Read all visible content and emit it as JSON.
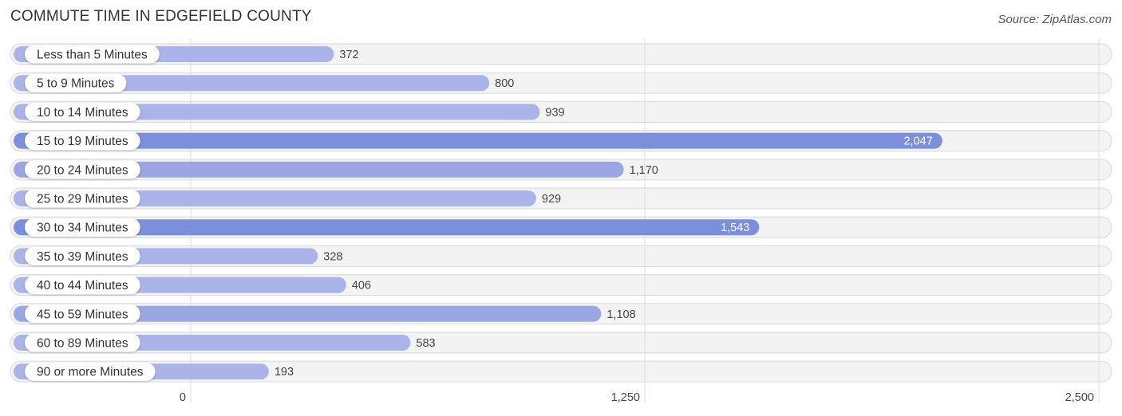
{
  "chart_data": {
    "type": "bar",
    "orientation": "horizontal",
    "title": "COMMUTE TIME IN EDGEFIELD COUNTY",
    "source": "Source: ZipAtlas.com",
    "categories": [
      "Less than 5 Minutes",
      "5 to 9 Minutes",
      "10 to 14 Minutes",
      "15 to 19 Minutes",
      "20 to 24 Minutes",
      "25 to 29 Minutes",
      "30 to 34 Minutes",
      "35 to 39 Minutes",
      "40 to 44 Minutes",
      "45 to 59 Minutes",
      "60 to 89 Minutes",
      "90 or more Minutes"
    ],
    "values": [
      372,
      800,
      939,
      2047,
      1170,
      929,
      1543,
      328,
      406,
      1108,
      583,
      193
    ],
    "value_labels": [
      "372",
      "800",
      "939",
      "2,047",
      "1,170",
      "929",
      "1,543",
      "328",
      "406",
      "1,108",
      "583",
      "193"
    ],
    "xlim": [
      0,
      2500
    ],
    "xticks": [
      0,
      1250,
      2500
    ],
    "xtick_labels": [
      "0",
      "1,250",
      "2,500"
    ],
    "grid": true,
    "colors": {
      "bar_light": "#aab4e8",
      "bar_strong": "#7b8fdc",
      "track": "#f2f2f2"
    }
  }
}
